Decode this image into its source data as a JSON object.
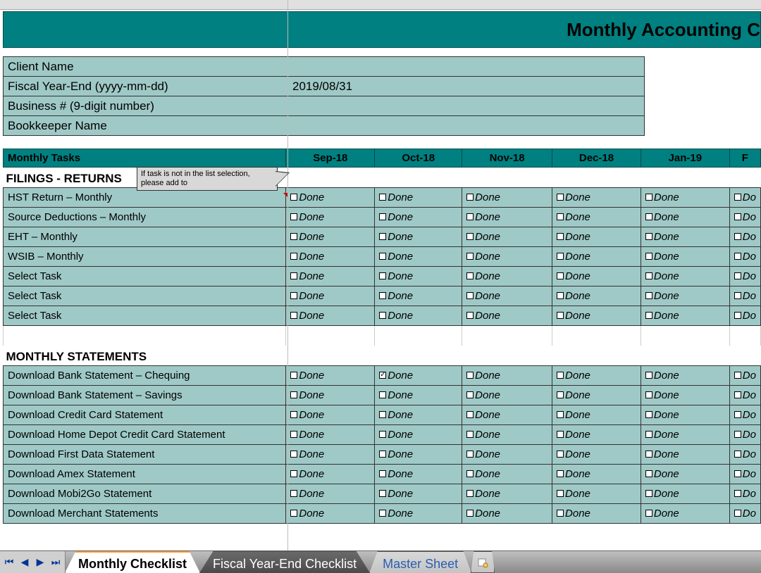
{
  "title": "Monthly Accounting C",
  "meta": {
    "rows": [
      {
        "label": "Client Name",
        "value": ""
      },
      {
        "label": "Fiscal Year-End (yyyy-mm-dd)",
        "value": "2019/08/31"
      },
      {
        "label": "Business # (9-digit number)",
        "value": ""
      },
      {
        "label": "Bookkeeper Name",
        "value": ""
      }
    ]
  },
  "columns": {
    "task_header": "Monthly Tasks",
    "months": [
      "Sep-18",
      "Oct-18",
      "Nov-18",
      "Dec-18",
      "Jan-19",
      "F"
    ]
  },
  "done_label": "Done",
  "done_label_short": "Do",
  "tooltip": "If task is not in the list selection, please add to",
  "sections": [
    {
      "heading": "FILINGS - RETURNS",
      "rows": [
        {
          "task": "HST Return – Monthly",
          "checked": [
            false,
            false,
            false,
            false,
            false,
            false
          ]
        },
        {
          "task": "Source Deductions – Monthly",
          "checked": [
            false,
            false,
            false,
            false,
            false,
            false
          ]
        },
        {
          "task": "EHT – Monthly",
          "checked": [
            false,
            false,
            false,
            false,
            false,
            false
          ]
        },
        {
          "task": "WSIB  – Monthly",
          "checked": [
            false,
            false,
            false,
            false,
            false,
            false
          ]
        },
        {
          "task": "Select Task",
          "checked": [
            false,
            false,
            false,
            false,
            false,
            false
          ]
        },
        {
          "task": "Select Task",
          "checked": [
            false,
            false,
            false,
            false,
            false,
            false
          ]
        },
        {
          "task": "Select Task",
          "checked": [
            false,
            false,
            false,
            false,
            false,
            false
          ]
        }
      ]
    },
    {
      "heading": "MONTHLY STATEMENTS",
      "rows": [
        {
          "task": "Download Bank Statement – Chequing",
          "checked": [
            false,
            true,
            false,
            false,
            false,
            false
          ]
        },
        {
          "task": "Download Bank Statement – Savings",
          "checked": [
            false,
            false,
            false,
            false,
            false,
            false
          ]
        },
        {
          "task": "Download Credit Card Statement",
          "checked": [
            false,
            false,
            false,
            false,
            false,
            false
          ]
        },
        {
          "task": "Download Home Depot Credit Card Statement",
          "checked": [
            false,
            false,
            false,
            false,
            false,
            false
          ]
        },
        {
          "task": "Download First Data Statement",
          "checked": [
            false,
            false,
            false,
            false,
            false,
            false
          ]
        },
        {
          "task": "Download Amex Statement",
          "checked": [
            false,
            false,
            false,
            false,
            false,
            false
          ]
        },
        {
          "task": "Download Mobi2Go Statement",
          "checked": [
            false,
            false,
            false,
            false,
            false,
            false
          ]
        },
        {
          "task": "Download Merchant Statements",
          "checked": [
            false,
            false,
            false,
            false,
            false,
            false
          ]
        }
      ]
    }
  ],
  "tabs": {
    "items": [
      {
        "label": "Monthly Checklist",
        "active": true
      },
      {
        "label": "Fiscal Year-End Checklist",
        "active": false
      },
      {
        "label": "Master Sheet",
        "active": false,
        "blue": true
      }
    ]
  }
}
